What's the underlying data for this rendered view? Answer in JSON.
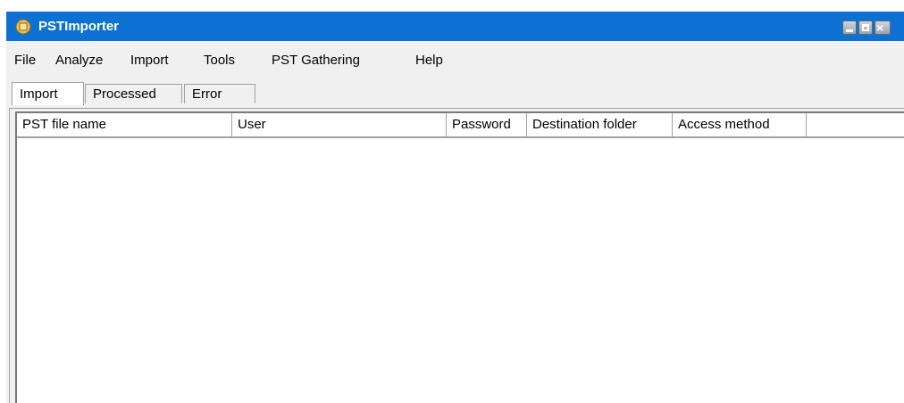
{
  "window": {
    "title": "PSTImporter"
  },
  "menu": [
    "File",
    "Analyze",
    "Import",
    "Tools",
    "PST Gathering",
    "Help"
  ],
  "tabs": [
    "Import",
    "Processed",
    "Error"
  ],
  "active_tab": "Import",
  "table": {
    "columns": [
      "PST file name",
      "User",
      "Password",
      "Destination folder",
      "Access method",
      ""
    ],
    "rows": []
  },
  "colors": {
    "titlebar": "#0d71d4",
    "window_bg": "#f0f0f0"
  }
}
